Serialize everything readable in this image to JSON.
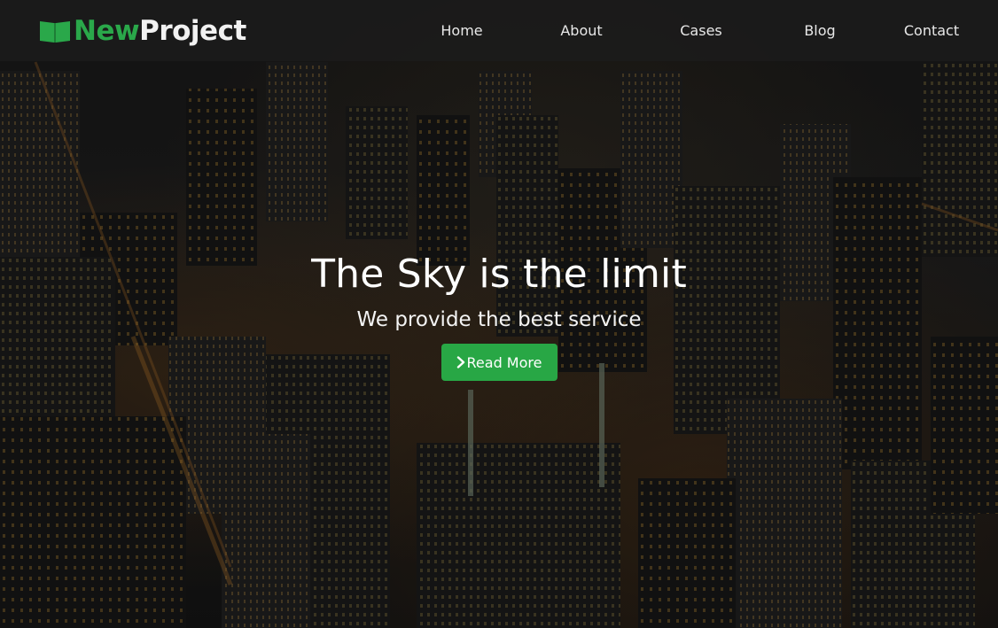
{
  "brand": {
    "name_part1": "New",
    "name_part2": "Project",
    "icon": "book-icon",
    "accent_color": "#2aa84a"
  },
  "nav": {
    "items": [
      {
        "label": "Home"
      },
      {
        "label": "About"
      },
      {
        "label": "Cases"
      },
      {
        "label": "Blog"
      },
      {
        "label": "Contact"
      }
    ]
  },
  "hero": {
    "title": "The Sky is the limit",
    "subtitle": "We provide the best service",
    "cta": {
      "label": "Read More",
      "icon": "chevron-right-icon",
      "color": "#28a745"
    },
    "background": "night-city-skyline"
  }
}
